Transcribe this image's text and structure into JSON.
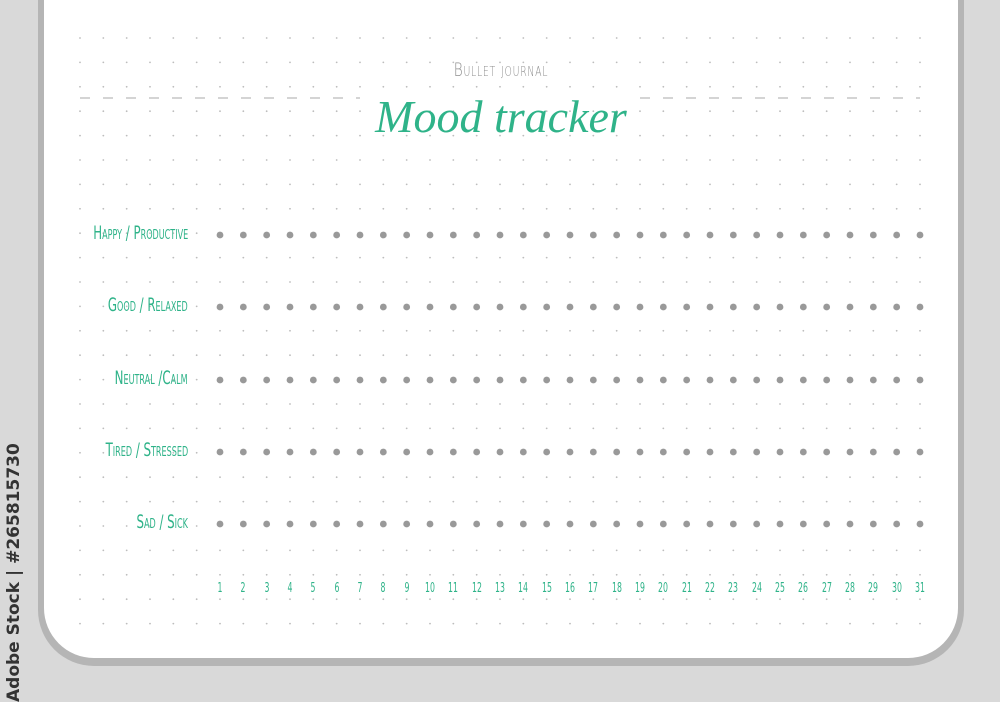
{
  "header": {
    "subtitle": "Bullet journal",
    "title": "Mood tracker"
  },
  "moods": [
    {
      "label": "Happy / Productive"
    },
    {
      "label": "Good / Relaxed"
    },
    {
      "label": "Neutral /Calm"
    },
    {
      "label": "Tired / Stressed"
    },
    {
      "label": "Sad / Sick"
    }
  ],
  "days": [
    "1",
    "2",
    "3",
    "4",
    "5",
    "6",
    "7",
    "8",
    "9",
    "10",
    "11",
    "12",
    "13",
    "14",
    "15",
    "16",
    "17",
    "18",
    "19",
    "20",
    "21",
    "22",
    "23",
    "24",
    "25",
    "26",
    "27",
    "28",
    "29",
    "30",
    "31"
  ],
  "watermark": "Adobe Stock | #265815730",
  "colors": {
    "accent": "#2fb389",
    "dot": "#999999",
    "grid_dot": "#bdbdbd",
    "background": "#d9d9d9",
    "border": "#b5b5b5"
  }
}
